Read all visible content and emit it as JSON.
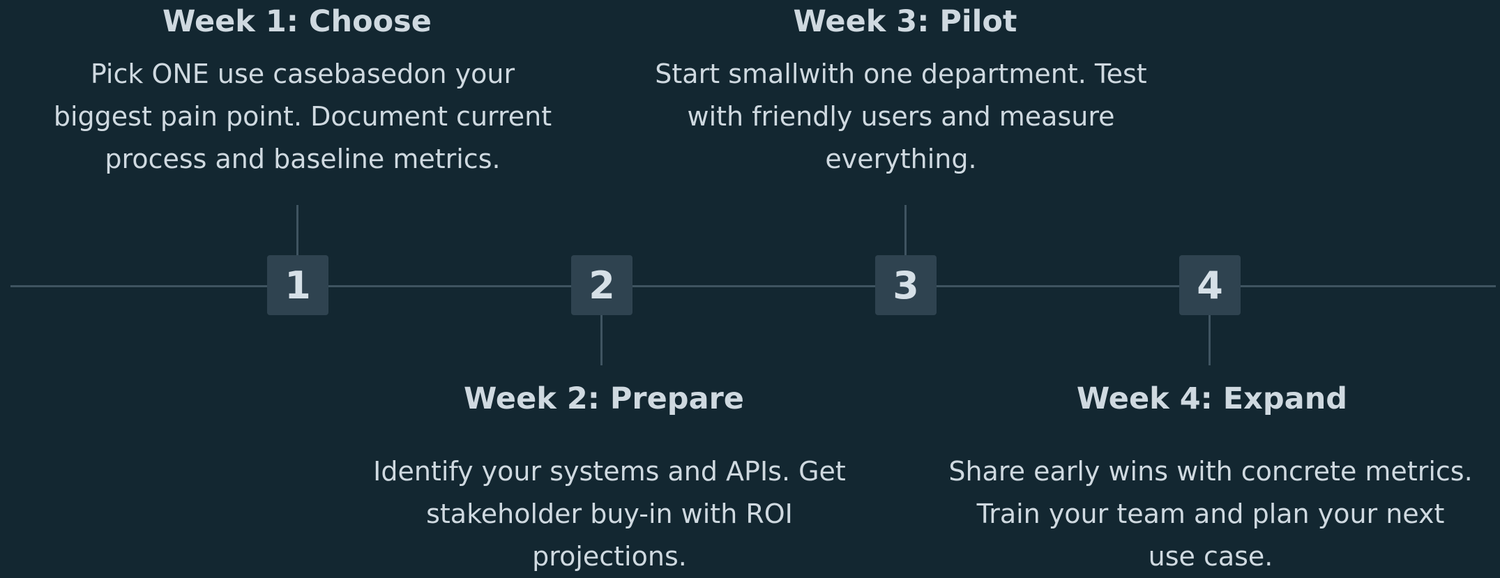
{
  "steps": [
    {
      "number": "1",
      "title": "Week 1: Choose",
      "lines": [
        "Pick ONE use casebasedon your",
        "biggest pain point. Document current",
        "process and baseline metrics."
      ]
    },
    {
      "number": "2",
      "title": "Week 2: Prepare",
      "lines": [
        "Identify your systems and APIs. Get",
        "stakeholder buy-in with ROI",
        "projections."
      ]
    },
    {
      "number": "3",
      "title": "Week 3: Pilot",
      "lines": [
        "Start smallwith one department. Test",
        "with friendly users and measure",
        "everything."
      ]
    },
    {
      "number": "4",
      "title": "Week 4: Expand",
      "lines": [
        "Share early wins with concrete metrics.",
        "Train your team and plan your next",
        "use case."
      ]
    }
  ]
}
